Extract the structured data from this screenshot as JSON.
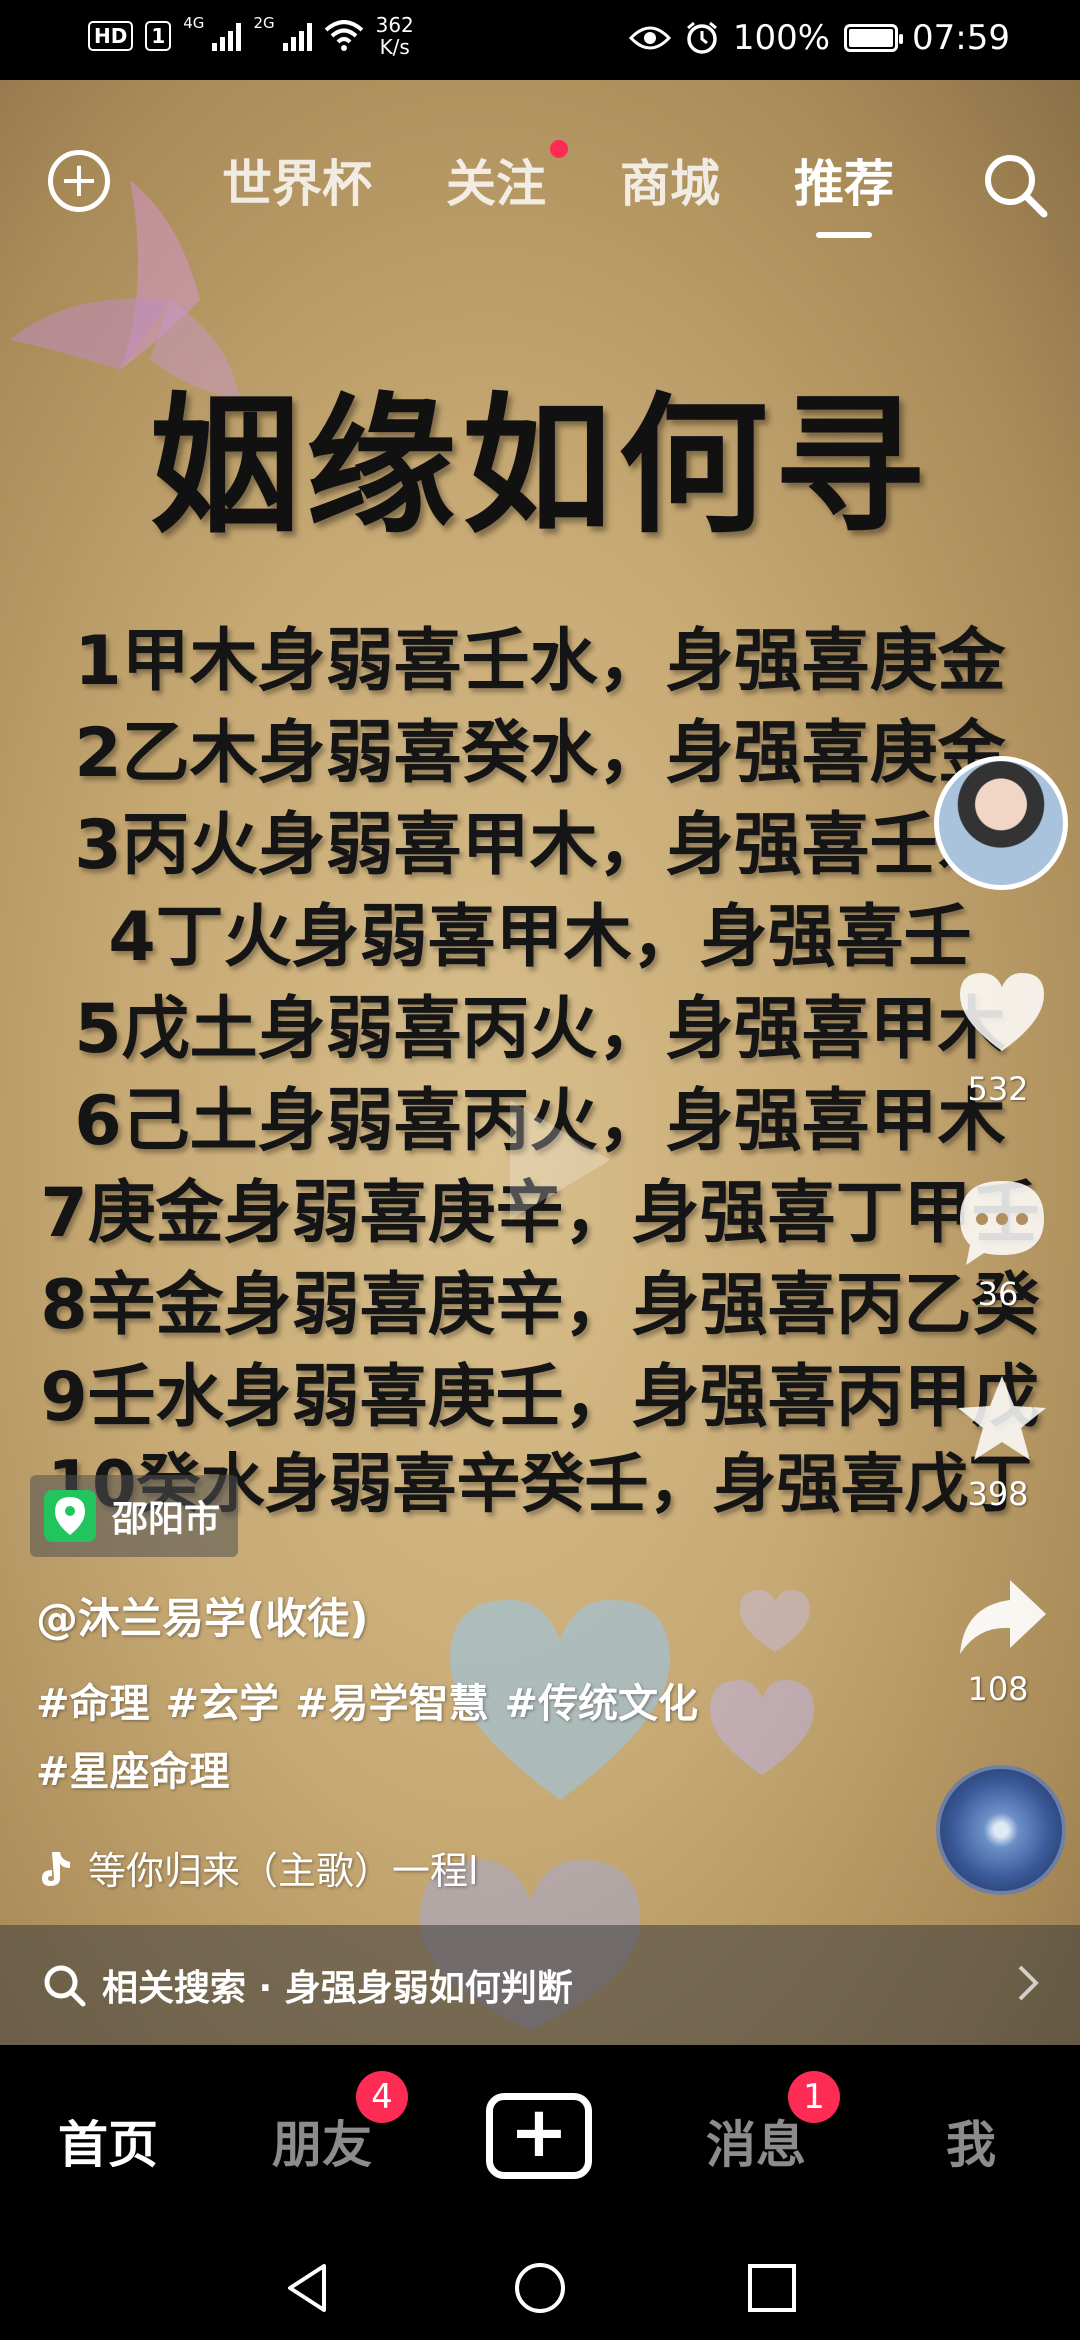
{
  "status_bar": {
    "hd_label": "HD",
    "sim_label": "1",
    "signal1_label": "4G",
    "signal2_label": "2G",
    "net_speed_value": "362",
    "net_speed_unit": "K/s",
    "battery_percent": "100%",
    "battery_level": 1.0,
    "time": "07:59"
  },
  "top_nav": {
    "tabs": [
      {
        "label": "世界杯"
      },
      {
        "label": "关注"
      },
      {
        "label": "商城"
      },
      {
        "label": "推荐"
      }
    ],
    "active_tab": "推荐",
    "follow_has_dot": true
  },
  "video": {
    "title": "姻缘如何寻",
    "lines": [
      "1甲木身弱喜壬水，身强喜庚金",
      "2乙木身弱喜癸水，身强喜庚金",
      "3丙火身弱喜甲木，身强喜壬水",
      "4丁火身弱喜甲木，身强喜壬",
      "5戊土身弱喜丙火，身强喜甲木",
      "6己土身弱喜丙火，身强喜甲木",
      "7庚金身弱喜庚辛，身强喜丁甲壬",
      "8辛金身弱喜庚辛，身强喜丙乙癸",
      "9壬水身弱喜庚壬，身强喜丙甲戊",
      "10癸水身弱喜辛癸壬，身强喜戊丁"
    ]
  },
  "right_rail": {
    "likes": "532",
    "comments": "36",
    "favorites": "398",
    "shares": "108"
  },
  "info": {
    "location": "邵阳市",
    "author": "@沐兰易学(收徒)",
    "hashtags": [
      "#命理",
      "#玄学",
      "#易学智慧",
      "#传统文化",
      "#星座命理"
    ],
    "music": "等你归来（主歌）一程l"
  },
  "related_search": {
    "label": "相关搜索 · 身强身弱如何判断"
  },
  "bottom_nav": {
    "home": "首页",
    "friends": "朋友",
    "friends_badge": "4",
    "messages": "消息",
    "messages_badge": "1",
    "me": "我"
  }
}
